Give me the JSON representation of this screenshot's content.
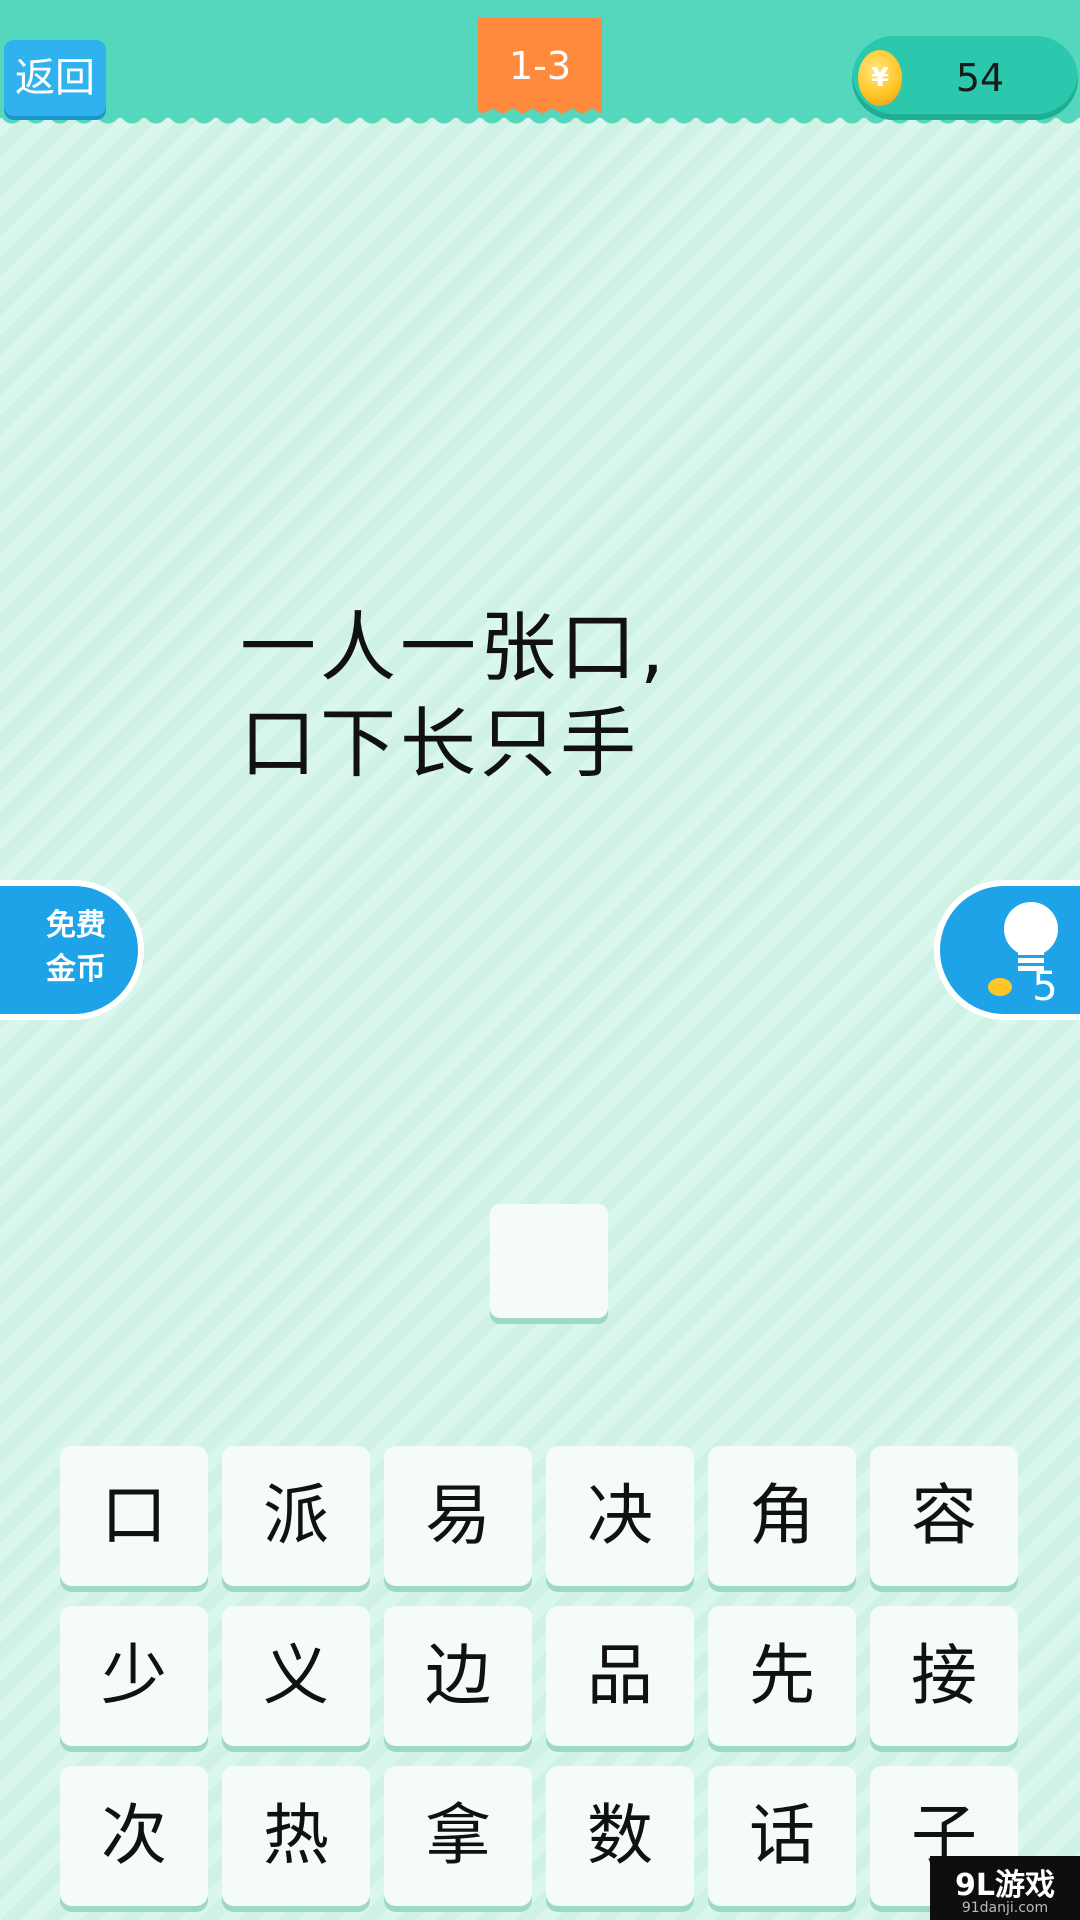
{
  "header": {
    "back_label": "返回",
    "level": "1-3",
    "coin_symbol": "¥",
    "coins": "54"
  },
  "riddle": {
    "line1": "一人一张口,",
    "line2": "口下长只手"
  },
  "side_buttons": {
    "free_coins_label_1": "免费",
    "free_coins_label_2": "金币",
    "hint_cost": "5"
  },
  "answer": {
    "slots": [
      ""
    ]
  },
  "keyboard": {
    "rows": [
      [
        "口",
        "派",
        "易",
        "决",
        "角",
        "容"
      ],
      [
        "少",
        "义",
        "边",
        "品",
        "先",
        "接"
      ],
      [
        "次",
        "热",
        "拿",
        "数",
        "话",
        "子"
      ]
    ]
  },
  "watermark": {
    "main": "9L游戏",
    "sub": "91danji.com"
  },
  "colors": {
    "header": "#55d7be",
    "accent_blue": "#1ea3e8",
    "level_tag": "#ff8a3d",
    "coin": "#ffc627"
  }
}
